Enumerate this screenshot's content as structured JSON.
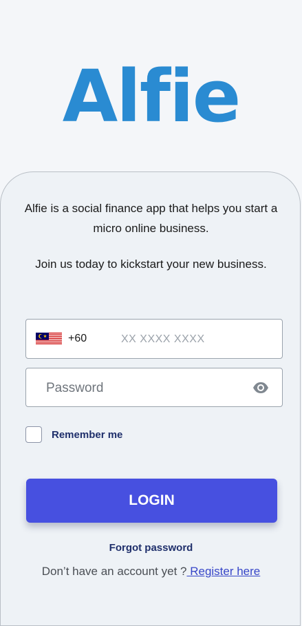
{
  "app": {
    "logo_text": "Alfie"
  },
  "intro": {
    "description": "Alfie is a social finance app that helps you start a micro online business.",
    "join_text": "Join us today to kickstart your new business."
  },
  "phone": {
    "flag_icon": "malaysia-flag-icon",
    "dial_code": "+60",
    "placeholder": "XX XXXX XXXX",
    "value": ""
  },
  "password": {
    "placeholder": "Password",
    "value": "",
    "toggle_icon": "eye-icon"
  },
  "remember": {
    "label": "Remember me",
    "checked": false
  },
  "actions": {
    "login_label": "LOGIN",
    "forgot_label": "Forgot password",
    "register_prompt": "Don’t have an account yet ?",
    "register_link": " Register here"
  },
  "colors": {
    "brand": "#2a8bd2",
    "primary_button": "#4750e0",
    "link": "#3746c8",
    "dark_text": "#1f2f6b"
  }
}
